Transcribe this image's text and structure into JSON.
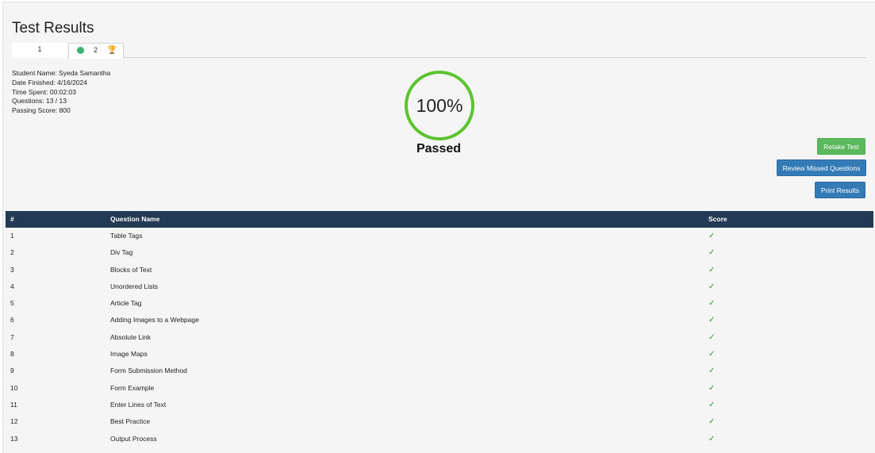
{
  "page": {
    "title": "Test Results"
  },
  "tabs": [
    {
      "label": "1"
    },
    {
      "label": "2",
      "dot_icon": "status-dot-icon",
      "trophy_icon": "trophy-icon"
    }
  ],
  "info": {
    "student_name": "Student Name: Syeda Samantha",
    "date_finished": "Date Finished: 4/16/2024",
    "time_spent": "Time Spent: 00:02:03",
    "questions": "Questions: 13 / 13",
    "passing_score": "Passing Score: 800"
  },
  "result": {
    "score": "100%",
    "status": "Passed",
    "ring_color": "#5cc42e"
  },
  "buttons": {
    "retake": "Retake Test",
    "review": "Review Missed Questions",
    "print": "Print Results"
  },
  "table": {
    "headers": [
      "#",
      "Question Name",
      "Score"
    ],
    "rows": [
      {
        "num": "1",
        "name": "Table Tags",
        "score": "✓"
      },
      {
        "num": "2",
        "name": "Div Tag",
        "score": "✓"
      },
      {
        "num": "3",
        "name": "Blocks of Text",
        "score": "✓"
      },
      {
        "num": "4",
        "name": "Unordered Lists",
        "score": "✓"
      },
      {
        "num": "5",
        "name": "Article Tag",
        "score": "✓"
      },
      {
        "num": "6",
        "name": "Adding Images to a Webpage",
        "score": "✓"
      },
      {
        "num": "7",
        "name": "Absolute Link",
        "score": "✓"
      },
      {
        "num": "8",
        "name": "Image Maps",
        "score": "✓"
      },
      {
        "num": "9",
        "name": "Form Submission Method",
        "score": "✓"
      },
      {
        "num": "10",
        "name": "Form Example",
        "score": "✓"
      },
      {
        "num": "11",
        "name": "Enter Lines of Text",
        "score": "✓"
      },
      {
        "num": "12",
        "name": "Best Practice",
        "score": "✓"
      },
      {
        "num": "13",
        "name": "Output Process",
        "score": "✓"
      }
    ]
  },
  "colors": {
    "header_bg": "#233a55",
    "pass_green": "#5cb85c",
    "primary_blue": "#337ab7"
  }
}
